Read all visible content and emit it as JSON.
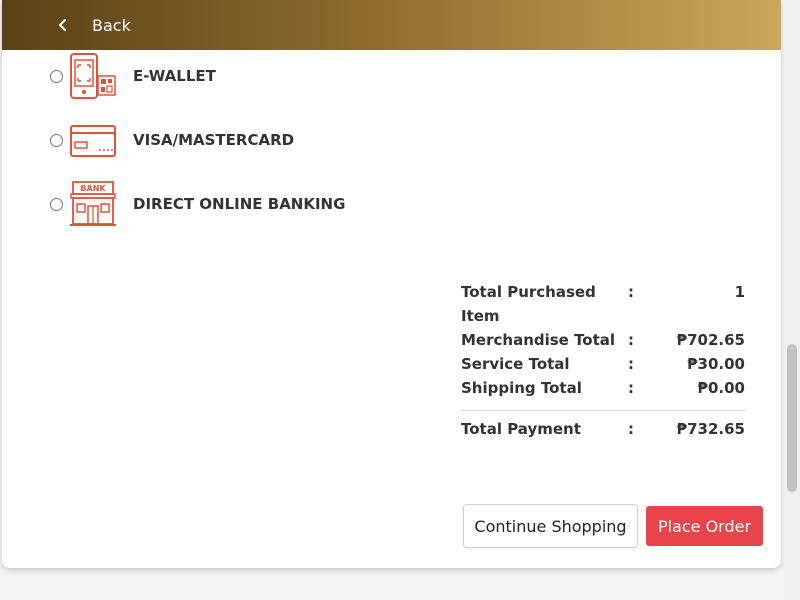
{
  "header": {
    "back_label": "Back",
    "back_icon": "chevron-left-icon"
  },
  "payment_options": [
    {
      "label": "E-WALLET",
      "icon": "e-wallet-icon"
    },
    {
      "label": "VISA/MASTERCARD",
      "icon": "credit-card-icon"
    },
    {
      "label": "DIRECT ONLINE BANKING",
      "icon": "bank-icon",
      "icon_text": "BANK"
    }
  ],
  "summary": {
    "separator": ":",
    "rows": [
      {
        "label": "Total Purchased Item",
        "value": "1"
      },
      {
        "label": "Merchandise Total",
        "value": "₱702.65"
      },
      {
        "label": "Service Total",
        "value": "₱30.00"
      },
      {
        "label": "Shipping Total",
        "value": "₱0.00"
      }
    ],
    "total": {
      "label": "Total Payment",
      "value": "₱732.65"
    }
  },
  "actions": {
    "continue_label": "Continue Shopping",
    "place_order_label": "Place Order"
  },
  "colors": {
    "accent_red": "#e9434b",
    "icon_red": "#e0533a",
    "header_gradient": [
      "#5a4216",
      "#c9a85a"
    ]
  }
}
